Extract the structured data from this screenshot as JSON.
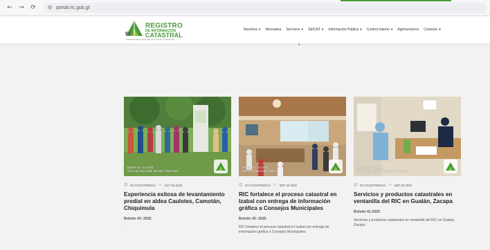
{
  "browser": {
    "url": "portal.ric.gob.gt",
    "back_icon": "arrow-left",
    "forward_icon": "arrow-right",
    "reload_icon": "reload",
    "site_icon": "site-settings"
  },
  "header": {
    "logo": {
      "line1": "REGISTRO",
      "line2": "DE INFORMACIÓN",
      "line3": "CATASTRAL",
      "ric": "RIC",
      "tagline": "Fortaleciendo la seguridad de la tierra en Guatemala"
    },
    "menu": [
      {
        "label": "Nosotros",
        "dropdown": true
      },
      {
        "label": "Normativa",
        "dropdown": false
      },
      {
        "label": "Servicios",
        "dropdown": true
      },
      {
        "label": "SEICAT",
        "dropdown": true
      },
      {
        "label": "Información Pública",
        "dropdown": true
      },
      {
        "label": "Control Interno",
        "dropdown": true
      },
      {
        "label": "Agrimensores",
        "dropdown": false
      },
      {
        "label": "Contacto",
        "dropdown": true
      }
    ],
    "accent_color": "#4a9a3b"
  },
  "cards": [
    {
      "caption1": "Boletín No. 43-2025",
      "caption2": "Dirección Municipal Zacapa Chiquimula",
      "author": "BY PCONTRERAS",
      "date": "OCT 06 2025",
      "title": "Experiencia exitosa de levantamiento predial en aldea Caulotes, Camotán, Chiquimula",
      "subtitle": "Boletín 43- 2025",
      "excerpt": "."
    },
    {
      "caption1": "Boletín No. 42-2025",
      "caption2": "Dirección Municipal Izabal",
      "author": "BY PCONTRERAS",
      "date": "SEP 30 2025",
      "title": "RIC fortalece el proceso catastral en Izabal con entrega de información gráfica a Consejos Municipales",
      "subtitle": "Boletín 42- 2025",
      "excerpt": "RIC fortalece el proceso catastral en Izabal con entrega de información gráfica a Consejos Municipales"
    },
    {
      "caption1": "Boletín No. 41-2025",
      "caption2": "Dirección Municipal Zacapa Chiquimula",
      "author": "BY PCONTRERAS",
      "date": "SEP 30 2025",
      "title": "Servicios y productos catastrales en ventanilla del RIC en Gualán, Zacapa",
      "subtitle": "Boletín 41-2025",
      "excerpt": "Servicios y productos catastrales en ventanilla del RIC en Gualán, Zacapa"
    }
  ]
}
